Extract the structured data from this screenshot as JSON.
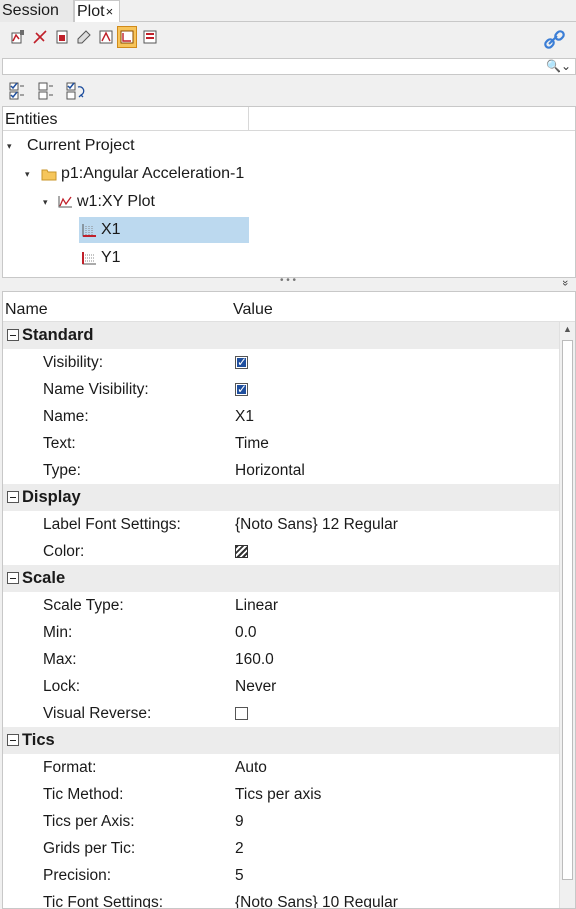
{
  "tabs": [
    {
      "label": "Session"
    },
    {
      "label": "Plot",
      "close": "×"
    }
  ],
  "toolbar": {
    "buttons": [
      "plot-icon",
      "axis-icon",
      "curve-icon",
      "pen-icon",
      "datum-icon",
      "frame-icon",
      "legend-icon"
    ],
    "active_index": 5,
    "link": "link-icon"
  },
  "search": {
    "value": "",
    "placeholder": "",
    "icon": "🔍⌄"
  },
  "tree": {
    "header": "Entities",
    "nodes": [
      {
        "label": "Current Project",
        "twisty": "▾"
      },
      {
        "label": "p1:Angular Acceleration-1",
        "twisty": "▾"
      },
      {
        "label": "w1:XY Plot",
        "twisty": "▾"
      },
      {
        "label": "X1",
        "selected": true
      },
      {
        "label": "Y1"
      }
    ]
  },
  "splitter": {
    "dots": "• • •",
    "chevron": "»"
  },
  "props": {
    "header": {
      "name": "Name",
      "value": "Value"
    },
    "groups": [
      {
        "title": "Standard",
        "rows": [
          {
            "key": "Visibility:",
            "type": "check",
            "checked": true
          },
          {
            "key": "Name Visibility:",
            "type": "check",
            "checked": true
          },
          {
            "key": "Name:",
            "value": "X1"
          },
          {
            "key": "Text:",
            "value": "Time"
          },
          {
            "key": "Type:",
            "value": "Horizontal"
          }
        ]
      },
      {
        "title": "Display",
        "rows": [
          {
            "key": "Label Font Settings:",
            "value": "{Noto Sans} 12 Regular"
          },
          {
            "key": "Color:",
            "type": "swatch"
          }
        ]
      },
      {
        "title": "Scale",
        "rows": [
          {
            "key": "Scale Type:",
            "value": "Linear"
          },
          {
            "key": "Min:",
            "value": "0.0"
          },
          {
            "key": "Max:",
            "value": "160.0"
          },
          {
            "key": "Lock:",
            "value": "Never"
          },
          {
            "key": "Visual Reverse:",
            "type": "check",
            "checked": false
          }
        ]
      },
      {
        "title": "Tics",
        "rows": [
          {
            "key": "Format:",
            "value": "Auto"
          },
          {
            "key": "Tic Method:",
            "value": "Tics per axis"
          },
          {
            "key": "Tics per Axis:",
            "value": "9"
          },
          {
            "key": "Grids per Tic:",
            "value": "2"
          },
          {
            "key": "Precision:",
            "value": "5"
          },
          {
            "key": "Tic Font Settings:",
            "value": "{Noto Sans} 10 Regular"
          }
        ]
      }
    ]
  }
}
